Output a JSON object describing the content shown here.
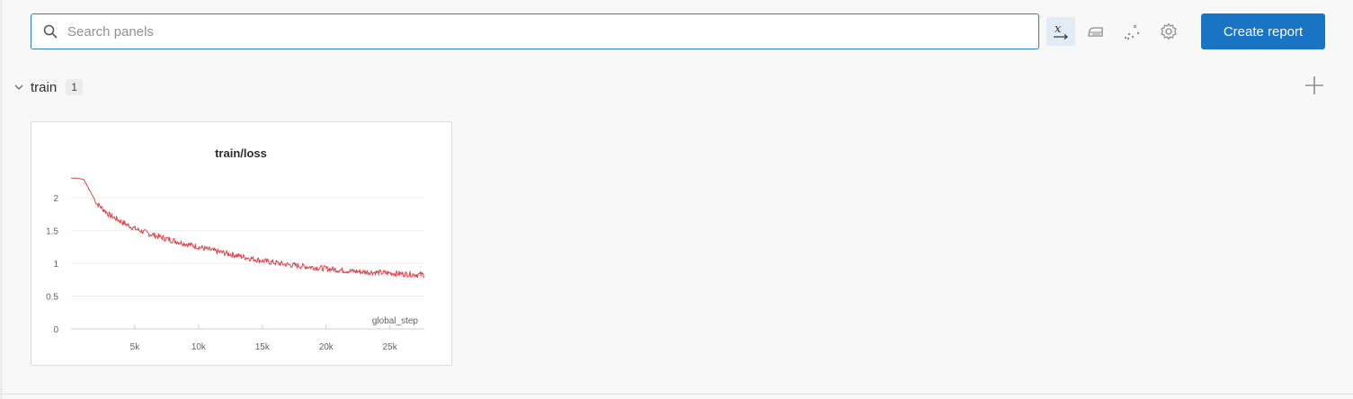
{
  "search": {
    "placeholder": "Search panels",
    "value": ""
  },
  "toolbar": {
    "x_axis_icon": "x-axis-icon",
    "smoothing_icon": "iron-icon",
    "outliers_icon": "scatter-icon",
    "settings_icon": "gear-icon",
    "create_report_label": "Create report"
  },
  "section": {
    "title": "train",
    "count": "1"
  },
  "colors": {
    "accent": "#1a74c5",
    "line": "#e0434b",
    "search_border": "#2e7fbd"
  },
  "chart_data": {
    "type": "line",
    "title": "train/loss",
    "xlabel": "global_step",
    "ylabel": "",
    "xlim": [
      0,
      27700
    ],
    "ylim": [
      0,
      2.4
    ],
    "xticks": [
      5000,
      10000,
      15000,
      20000,
      25000
    ],
    "xtick_labels": [
      "5k",
      "10k",
      "15k",
      "20k",
      "25k"
    ],
    "yticks": [
      0,
      0.5,
      1,
      1.5,
      2
    ],
    "ytick_labels": [
      "0",
      "0.5",
      "1",
      "1.5",
      "2"
    ],
    "grid": true,
    "series": [
      {
        "color": "#e0434b",
        "x": [
          0,
          500,
          1000,
          1500,
          2000,
          3000,
          4000,
          5000,
          6000,
          7000,
          8000,
          9000,
          10000,
          11000,
          12000,
          13000,
          14000,
          15000,
          16000,
          17000,
          18000,
          19000,
          20000,
          21000,
          22000,
          23000,
          24000,
          25000,
          26000,
          27000,
          27700
        ],
        "y": [
          2.3,
          2.3,
          2.28,
          2.1,
          1.92,
          1.74,
          1.63,
          1.53,
          1.46,
          1.4,
          1.35,
          1.3,
          1.25,
          1.2,
          1.16,
          1.12,
          1.08,
          1.04,
          1.01,
          0.98,
          0.96,
          0.94,
          0.92,
          0.9,
          0.88,
          0.87,
          0.86,
          0.85,
          0.84,
          0.83,
          0.83
        ]
      }
    ]
  }
}
